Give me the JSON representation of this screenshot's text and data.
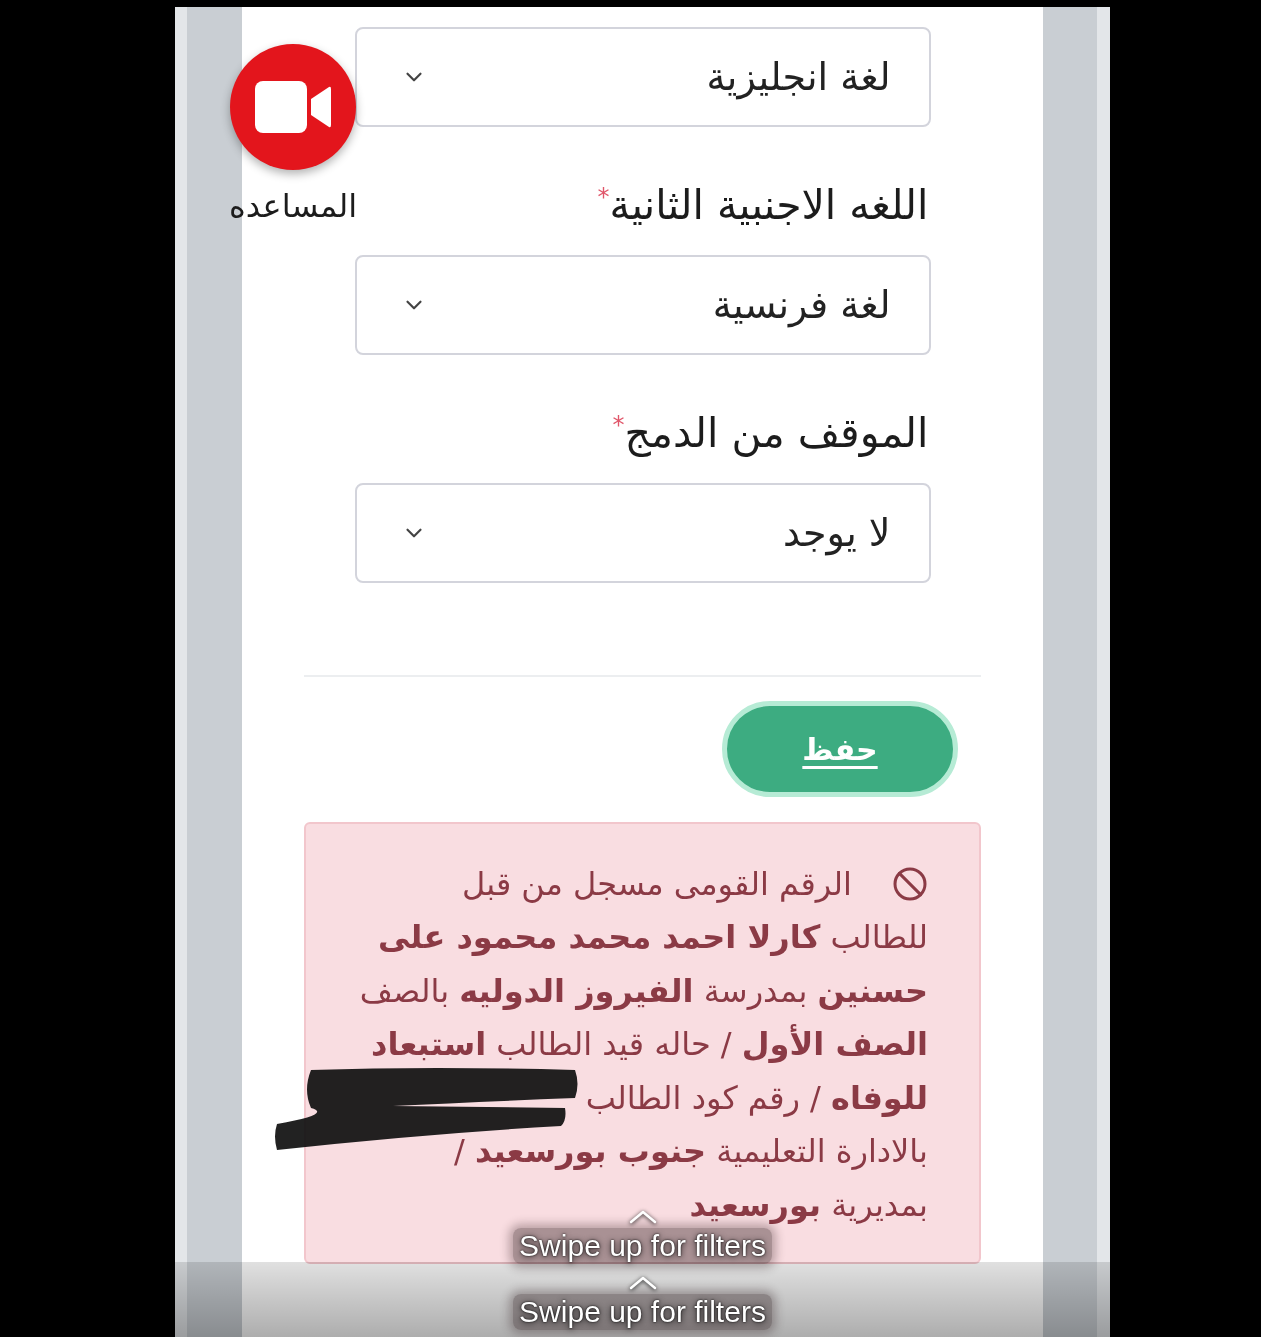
{
  "help_button": {
    "label": "المساعده"
  },
  "fields": [
    {
      "value": "لغة انجليزية"
    },
    {
      "label": "اللغه الاجنبية الثانية",
      "required_mark": "*",
      "value": "لغة فرنسية"
    },
    {
      "label": "الموقف من الدمج",
      "required_mark": "*",
      "value": "لا يوجد"
    }
  ],
  "save_button": {
    "label": "حفظ"
  },
  "alert": {
    "kind": "error",
    "message_lines": [
      "الرقم القومى مسجل من قبل",
      "للطالب **كارلا احمد محمد محمود على**",
      "**حسنين** بمدرسة **الفيروز الدوليه** بالصف",
      "**الصف الأول** / حاله قيد الطالب **استبعاد**",
      "**للوفاه** / رقم كود الطالب",
      "بالادارة التعليمية **جنوب بورسعيد** /",
      "بمديرية **بورسعيد**"
    ]
  },
  "overlay_hints": [
    {
      "label": "Swipe up for filters"
    },
    {
      "label": "Swipe up for filters"
    }
  ]
}
